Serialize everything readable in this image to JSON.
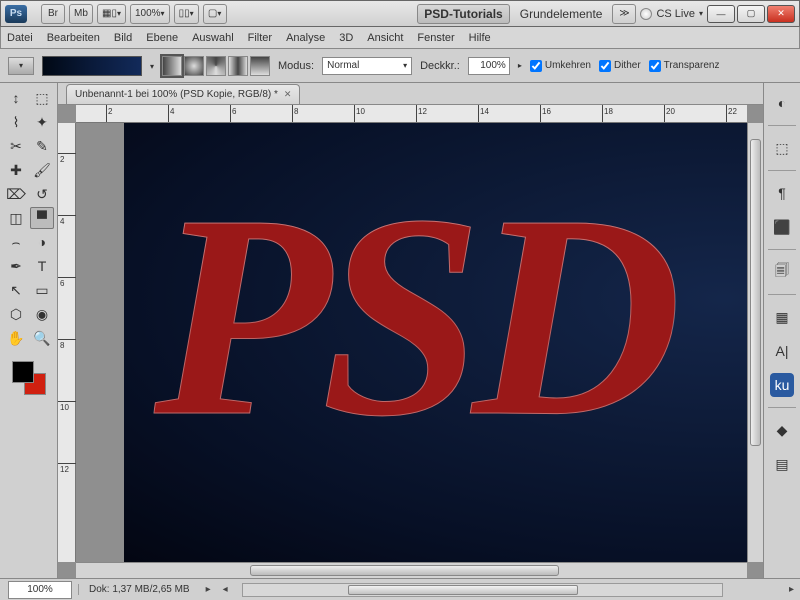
{
  "titlebar": {
    "app": "Ps",
    "br": "Br",
    "mb": "Mb",
    "zoom": "100%",
    "workspace_active": "PSD-Tutorials",
    "workspace_other": "Grundelemente",
    "cslive": "CS Live"
  },
  "menu": [
    "Datei",
    "Bearbeiten",
    "Bild",
    "Ebene",
    "Auswahl",
    "Filter",
    "Analyse",
    "3D",
    "Ansicht",
    "Fenster",
    "Hilfe"
  ],
  "options": {
    "modus_label": "Modus:",
    "modus_value": "Normal",
    "deckkr_label": "Deckkr.:",
    "deckkr_value": "100%",
    "chk_umkehren": "Umkehren",
    "chk_dither": "Dither",
    "chk_transparenz": "Transparenz"
  },
  "document": {
    "tab_title": "Unbenannt-1 bei 100% (PSD Kopie, RGB/8) *",
    "canvas_text": "PSD"
  },
  "ruler_h": [
    "2",
    "4",
    "6",
    "8",
    "10",
    "12",
    "14",
    "16",
    "18",
    "20",
    "22"
  ],
  "ruler_v": [
    "2",
    "4",
    "6",
    "8",
    "10",
    "12"
  ],
  "status": {
    "zoom": "100%",
    "docsize_label": "Dok:",
    "docsize_value": "1,37 MB/2,65 MB"
  },
  "tools": [
    "move",
    "marquee",
    "lasso",
    "wand",
    "crop",
    "eyedropper",
    "heal",
    "brush",
    "stamp",
    "history",
    "eraser",
    "gradient",
    "blur",
    "dodge",
    "pen",
    "type",
    "path",
    "shape",
    "3d",
    "3dcam",
    "hand",
    "zoom"
  ],
  "tool_glyphs": {
    "move": "↕",
    "marquee": "⬚",
    "lasso": "⌇",
    "wand": "✦",
    "crop": "✂",
    "eyedropper": "✎",
    "heal": "✚",
    "brush": "🖌",
    "stamp": "⌦",
    "history": "↺",
    "eraser": "◫",
    "gradient": "▀",
    "blur": "⌢",
    "dodge": "◑",
    "pen": "✒",
    "type": "T",
    "path": "↖",
    "shape": "▭",
    "3d": "⬡",
    "3dcam": "◉",
    "hand": "✋",
    "zoom": "🔍"
  },
  "dock_icons": [
    "◐",
    "⬚",
    "¶",
    "⬛",
    "🗐",
    "▦",
    "A|",
    "ku",
    "◆",
    "▤"
  ]
}
